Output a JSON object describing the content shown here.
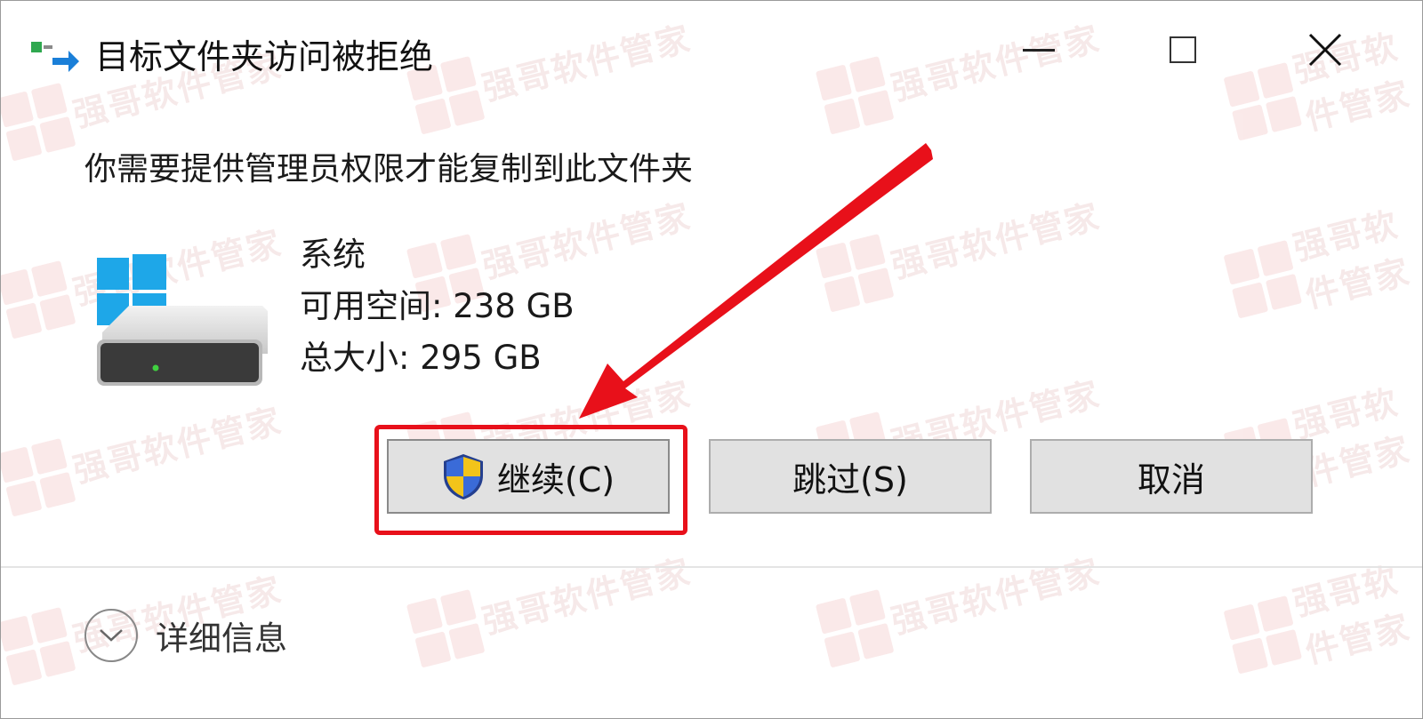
{
  "window": {
    "title": "目标文件夹访问被拒绝"
  },
  "message": "你需要提供管理员权限才能复制到此文件夹",
  "drive": {
    "name": "系统",
    "free_space": "可用空间: 238 GB",
    "total_size": "总大小: 295 GB"
  },
  "buttons": {
    "continue_label": "继续(C)",
    "skip_label": "跳过(S)",
    "cancel_label": "取消"
  },
  "details": {
    "label": "详细信息"
  },
  "watermark": {
    "text": "强哥软件管家"
  },
  "colors": {
    "highlight": "#e8101a",
    "windows_blue": "#1ea7e8",
    "button_face": "#e1e1e1"
  },
  "icons": [
    "copy-arrow-icon",
    "minimize-icon",
    "maximize-icon",
    "close-icon",
    "drive-icon",
    "uac-shield-icon",
    "chevron-down-icon"
  ]
}
